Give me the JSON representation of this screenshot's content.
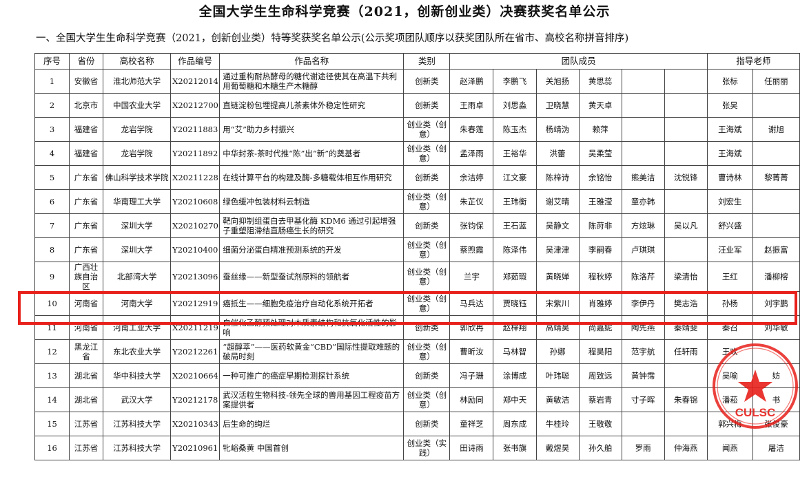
{
  "doc_title": "全国大学生生命科学竞赛（2021，创新创业类）决赛获奖名单公示",
  "section_title": "一、全国大学生生命科学竞赛（2021，创新创业类）特等奖获奖名单公示(公示奖项团队顺序以获奖团队所在省市、高校名称拼音排序)",
  "headers": {
    "no": "序号",
    "province": "省份",
    "school": "高校名称",
    "code": "作品编号",
    "title": "作品名称",
    "category": "类别",
    "members": "团队成员",
    "advisors": "指导老师"
  },
  "rows": [
    {
      "no": "1",
      "province": "安徽省",
      "school": "淮北师范大学",
      "code": "X20212014",
      "title": "通过重构耐热酵母的糖代谢途径使其在高温下共利用葡萄糖和木糖生产木糖醇",
      "category": "创新类",
      "members": [
        "赵泽鹏",
        "李鹏飞",
        "关旭扬",
        "黄思蕊",
        "",
        ""
      ],
      "advisors": [
        "张标",
        "任丽丽"
      ]
    },
    {
      "no": "2",
      "province": "北京市",
      "school": "中国农业大学",
      "code": "X20212700",
      "title": "直链淀粉包埋提高儿茶素体外稳定性研究",
      "category": "创新类",
      "members": [
        "王雨卓",
        "刘思淼",
        "卫晓慧",
        "黄天卓",
        "",
        ""
      ],
      "advisors": [
        "张昊",
        ""
      ]
    },
    {
      "no": "3",
      "province": "福建省",
      "school": "龙岩学院",
      "code": "Y20211883",
      "title": "用“艾”助力乡村振兴",
      "category": "创业类（创意）",
      "members": [
        "朱春莲",
        "陈玉杰",
        "杨靖沩",
        "赖萍",
        "",
        ""
      ],
      "advisors": [
        "王海斌",
        "谢旭"
      ]
    },
    {
      "no": "4",
      "province": "福建省",
      "school": "龙岩学院",
      "code": "Y20211892",
      "title": "中华封茶-茶时代推“陈”出“新”的奠基者",
      "category": "创业类（创意）",
      "members": [
        "孟泽雨",
        "王裕华",
        "洪蕾",
        "吴柔莹",
        "",
        ""
      ],
      "advisors": [
        "王海斌",
        ""
      ]
    },
    {
      "no": "5",
      "province": "广东省",
      "school": "佛山科学技术学院",
      "code": "X20211228",
      "title": "在线计算平台的构建及酶-多糖载体相互作用研究",
      "category": "创新类",
      "members": [
        "余洁婷",
        "江文豪",
        "陈梓诗",
        "余铭怡",
        "熊美洁",
        "沈锐锋"
      ],
      "advisors": [
        "曹诗林",
        "黎菁菁"
      ]
    },
    {
      "no": "6",
      "province": "广东省",
      "school": "华南理工大学",
      "code": "Y20210608",
      "title": "绿色缓冲包装材料云制造",
      "category": "创业类（创意）",
      "members": [
        "朱芷仪",
        "王玮衡",
        "谢艾晴",
        "王雅滢",
        "童亦韩",
        ""
      ],
      "advisors": [
        "刘宏生",
        ""
      ]
    },
    {
      "no": "7",
      "province": "广东省",
      "school": "深圳大学",
      "code": "X20210270",
      "title": "靶向抑制组蛋白去甲基化酶 KDM6 通过引起增强子重塑阻滞结直肠癌生长的研究",
      "category": "创新类",
      "members": [
        "张钧保",
        "王石蓝",
        "吴静文",
        "陈莳非",
        "方炫琳",
        "吴以凡"
      ],
      "advisors": [
        "舒兴盛",
        ""
      ]
    },
    {
      "no": "8",
      "province": "广东省",
      "school": "深圳大学",
      "code": "Y20210400",
      "title": "细菌分泌蛋白精准预测系统的开发",
      "category": "创业类（创意）",
      "members": [
        "蔡煦霞",
        "陈泽伟",
        "吴津津",
        "李嗣春",
        "卢琪琪",
        ""
      ],
      "advisors": [
        "汪业军",
        "赵振富"
      ]
    },
    {
      "no": "9",
      "province": "广西壮族自治区",
      "school": "北部湾大学",
      "code": "Y20213096",
      "title": "蚕丝缘——新型蚕试剂原料的领航者",
      "category": "创业类（创意）",
      "members": [
        "兰宇",
        "郑茹瑕",
        "黄晓婵",
        "程秋婷",
        "陈洛芹",
        "梁清怡"
      ],
      "advisors": [
        "王红",
        "潘柳榕"
      ]
    },
    {
      "no": "10",
      "province": "河南省",
      "school": "河南大学",
      "code": "Y20212919",
      "title": "癌抵生——细胞免疫治疗自动化系统开拓者",
      "category": "创业类（创意）",
      "members": [
        "马兵达",
        "贾晓钰",
        "宋紫川",
        "肖雅婷",
        "李伊丹",
        "樊志浩"
      ],
      "advisors": [
        "孙杨",
        "刘宇鹏"
      ]
    },
    {
      "no": "11",
      "province": "河南省",
      "school": "河南工业大学",
      "code": "X20211219",
      "title": "自催化乙醇预处理对木质素结构和抗氧化活性的影响",
      "category": "创新类",
      "members": [
        "郭欣冉",
        "赵梓翔",
        "高靖昊",
        "尚嘉妮",
        "陶先燕",
        "秦靖斐"
      ],
      "advisors": [
        "秦召",
        "刘华敏"
      ]
    },
    {
      "no": "12",
      "province": "黑龙江省",
      "school": "东北农业大学",
      "code": "Y20212261",
      "title": "“超醇萃”——医药软黄金“CBD”国际性提取难题的破局时刻",
      "category": "创业类（创意）",
      "members": [
        "曹昕汝",
        "马林智",
        "孙娜",
        "程昊阳",
        "范宇航",
        "任轩雨"
      ],
      "advisors": [
        "王欢",
        ""
      ]
    },
    {
      "no": "13",
      "province": "湖北省",
      "school": "华中科技大学",
      "code": "X20210664",
      "title": "一种可推广的癌症早期检测探针系统",
      "category": "创新类",
      "members": [
        "冯子珊",
        "涂博成",
        "叶玮聪",
        "周致远",
        "黄钟霈",
        ""
      ],
      "advisors": [
        "吴喻",
        "妨"
      ]
    },
    {
      "no": "14",
      "province": "湖北省",
      "school": "武汉大学",
      "code": "Y20212178",
      "title": "武汉活粒生物科技-领先全球的兽用基因工程疫苗方案提供者",
      "category": "创业类（创意）",
      "members": [
        "林励同",
        "郑中天",
        "黄敏洁",
        "蔡岩青",
        "寸子晖",
        "朱春锦"
      ],
      "advisors": [
        "潘菘",
        "书"
      ]
    },
    {
      "no": "15",
      "province": "江苏省",
      "school": "江苏科技大学",
      "code": "X20210343",
      "title": "后生命的绚烂",
      "category": "创新类",
      "members": [
        "童祥芝",
        "周东成",
        "牛桂玲",
        "王敬敬",
        "",
        ""
      ],
      "advisors": [
        "郭兴梅",
        "张俊豪"
      ]
    },
    {
      "no": "16",
      "province": "江苏省",
      "school": "江苏科技大学",
      "code": "Y20210961",
      "title": "牝峪桑黄 中国首创",
      "category": "创业类（实践）",
      "members": [
        "田诗雨",
        "张书旗",
        "戴煜昊",
        "孙久舶",
        "罗雨",
        "仲海燕"
      ],
      "advisors": [
        "闻燕",
        "屠洁"
      ]
    }
  ],
  "seal": {
    "text": "CULSC",
    "color": "#e8201b"
  },
  "highlight_color": "#e8201b"
}
